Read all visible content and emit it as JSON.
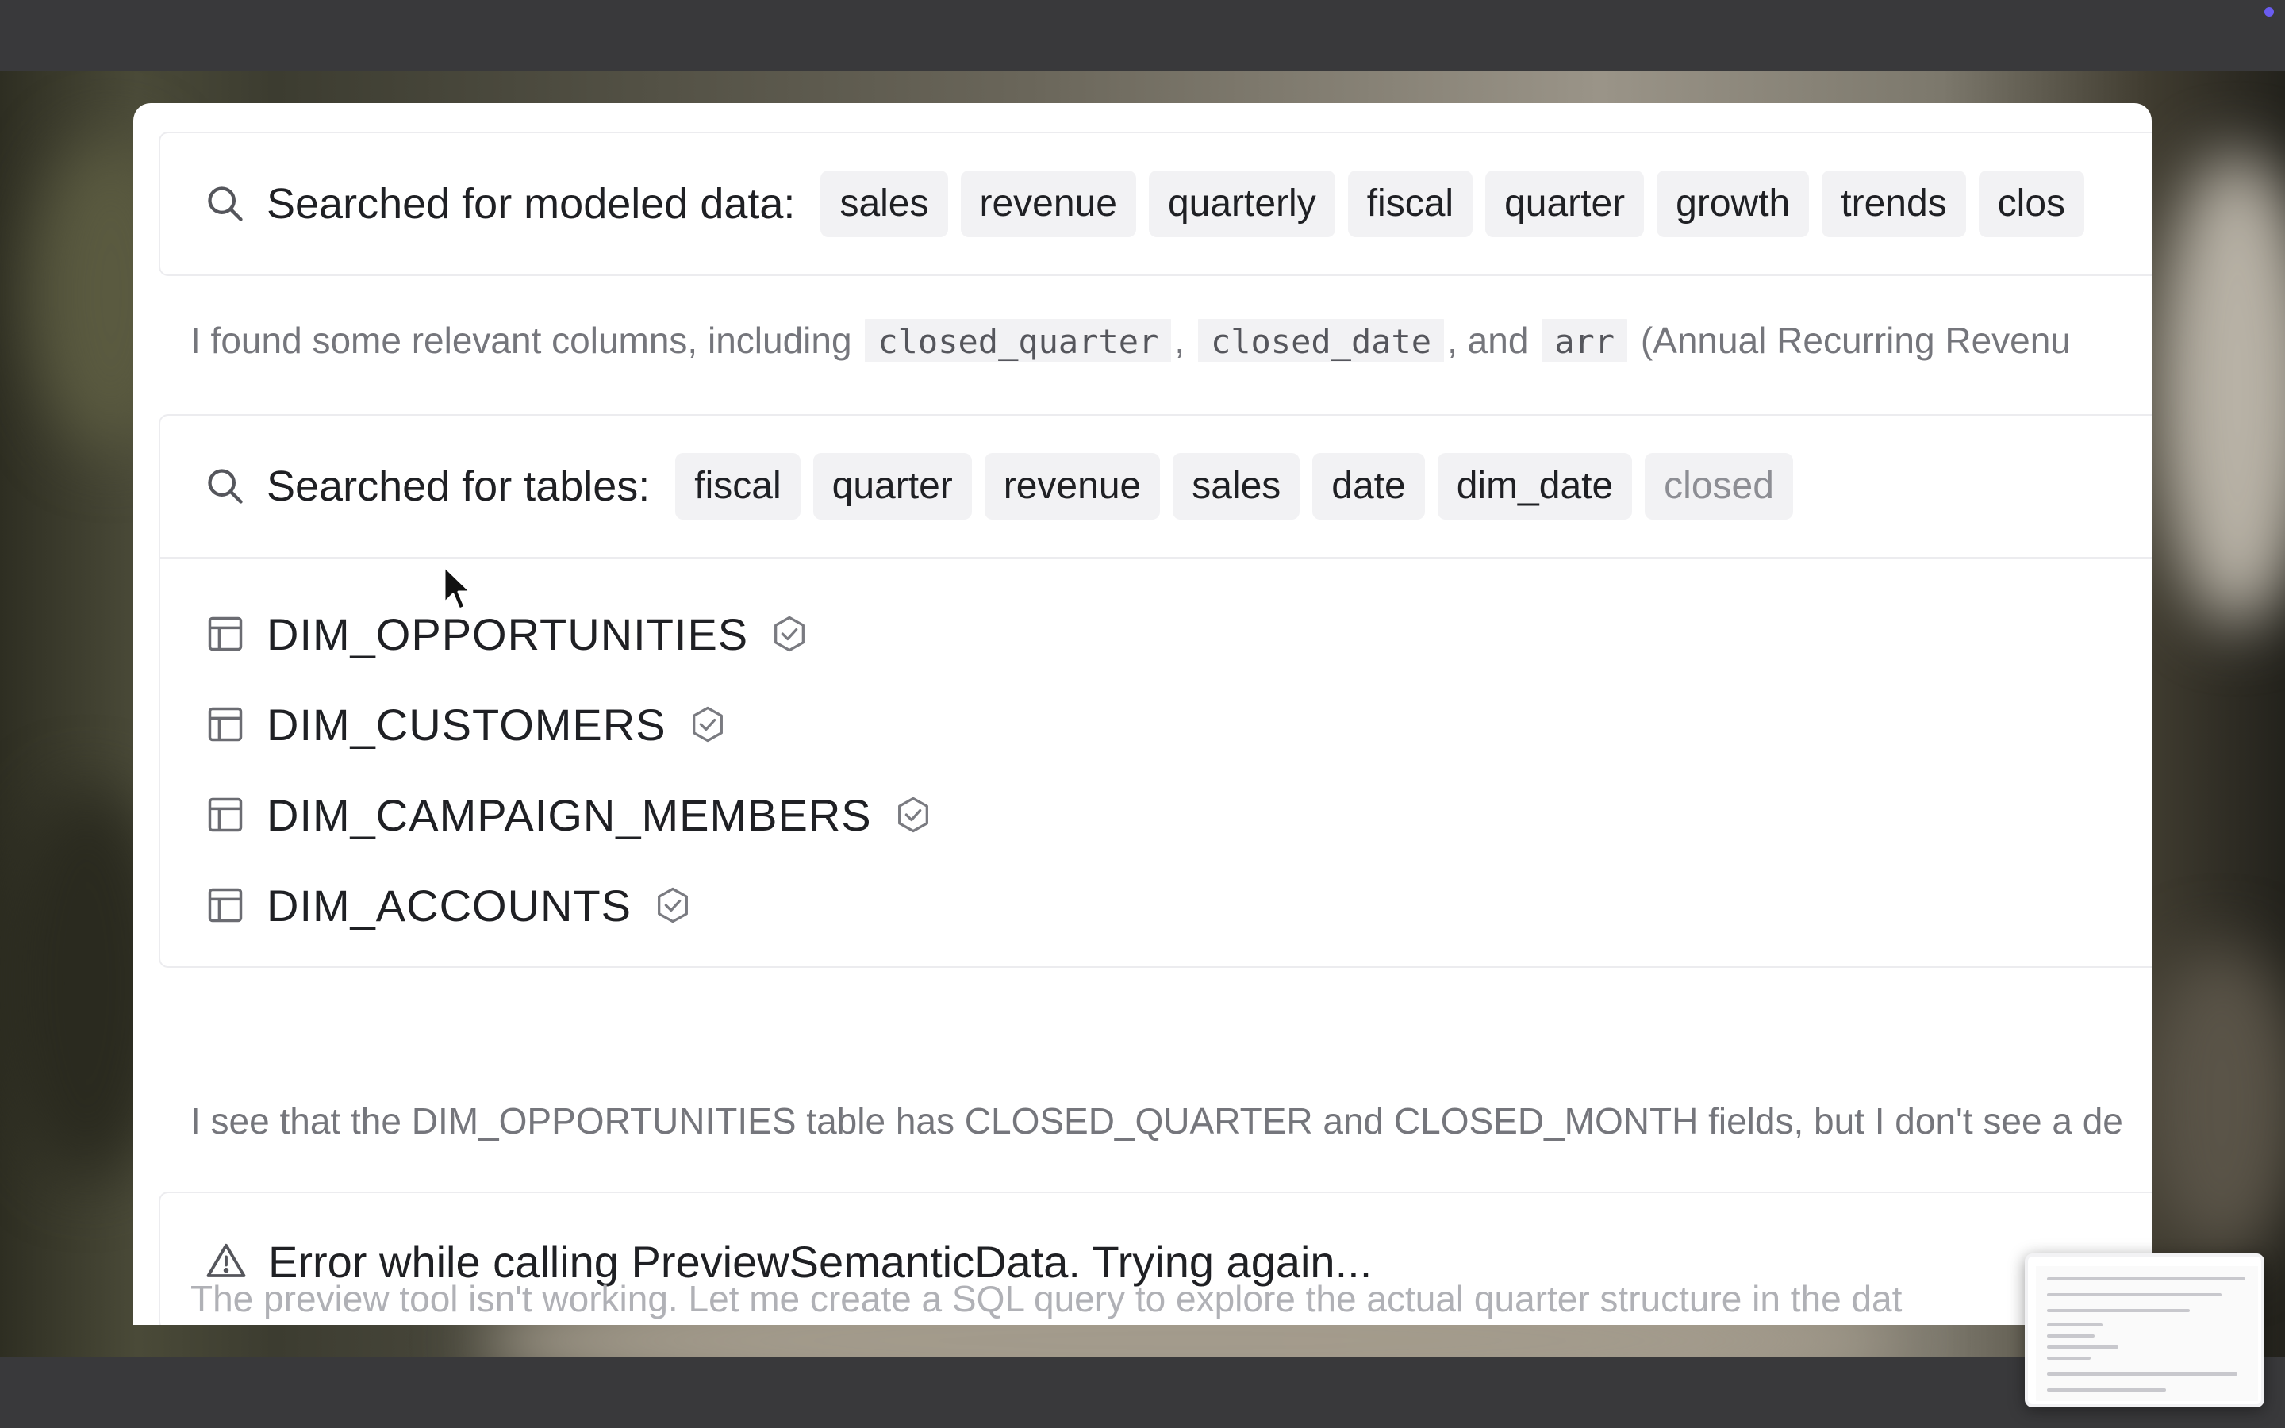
{
  "search_modeled": {
    "label": "Searched for modeled data:",
    "chips": [
      "sales",
      "revenue",
      "quarterly",
      "fiscal",
      "quarter",
      "growth",
      "trends",
      "clos"
    ]
  },
  "message1": {
    "prefix": "I found some relevant columns, including",
    "code1": "closed_quarter",
    "comma": ",",
    "code2": "closed_date",
    "and_text": ", and",
    "code3": "arr",
    "suffix": "(Annual Recurring Revenu"
  },
  "search_tables": {
    "label": "Searched for tables:",
    "chips": [
      "fiscal",
      "quarter",
      "revenue",
      "sales",
      "date",
      "dim_date",
      "closed"
    ]
  },
  "tables": [
    {
      "name": "DIM_OPPORTUNITIES",
      "icon": "table-icon",
      "badge_icon": "verified-badge-icon"
    },
    {
      "name": "DIM_CUSTOMERS",
      "icon": "table-icon",
      "badge_icon": "verified-badge-icon"
    },
    {
      "name": "DIM_CAMPAIGN_MEMBERS",
      "icon": "table-icon",
      "badge_icon": "verified-badge-icon"
    },
    {
      "name": "DIM_ACCOUNTS",
      "icon": "table-icon",
      "badge_icon": "verified-badge-icon"
    }
  ],
  "message2": "I see that the DIM_OPPORTUNITIES table has CLOSED_QUARTER and CLOSED_MONTH fields, but I don't see a de",
  "error": {
    "icon": "warning-icon",
    "text": "Error while calling PreviewSemanticData. Trying again..."
  },
  "message3": "The preview tool isn't working. Let me create a SQL query to explore the actual quarter structure in the dat",
  "colors": {
    "text": "#1f2024",
    "muted": "#75767c",
    "chip_bg": "#f2f2f4",
    "border": "#ececef",
    "accent_dot": "#6a5cf0"
  }
}
